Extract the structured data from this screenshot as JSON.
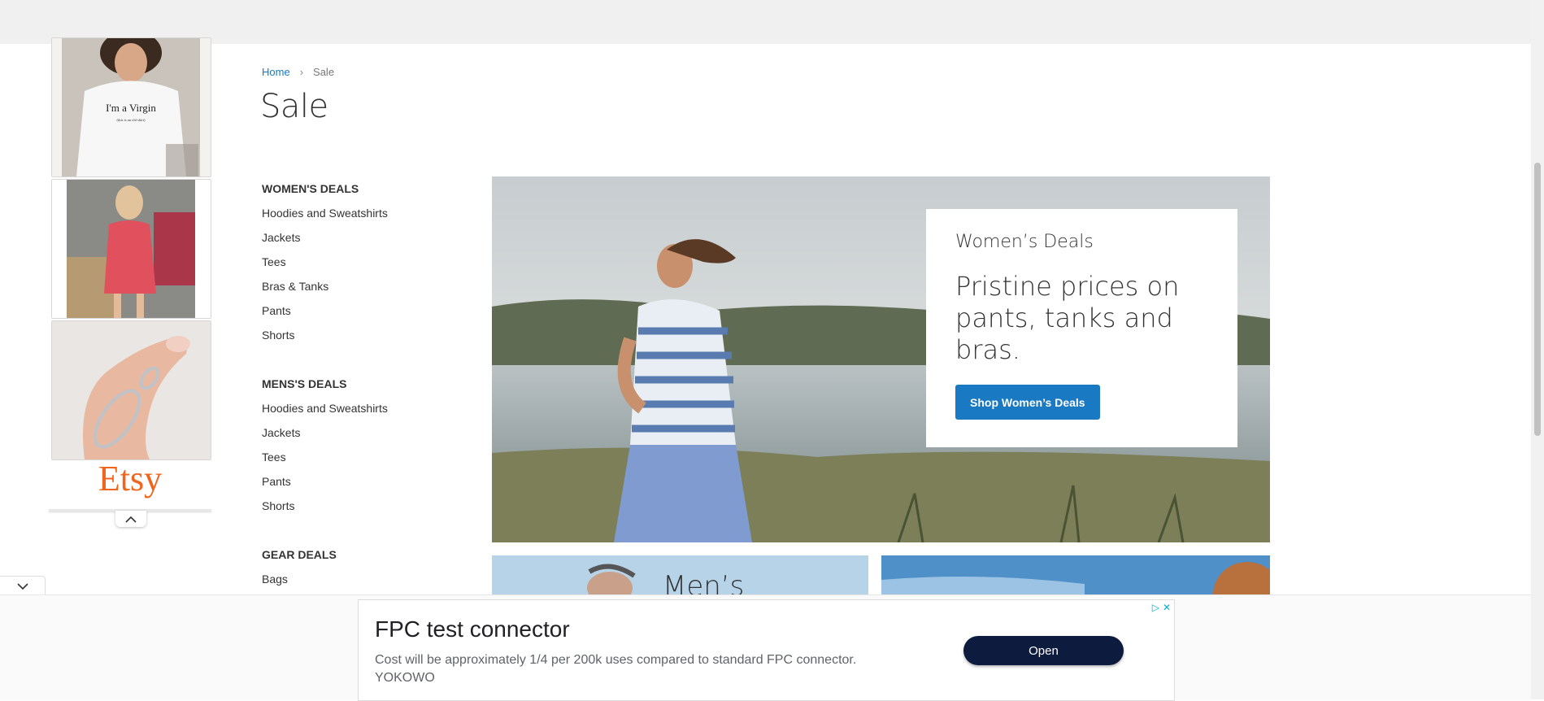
{
  "left_ad": {
    "shirt_text_line1": "I'm a Virgin",
    "shirt_text_line2": "(this is an old shirt)",
    "brand": "Etsy",
    "adchoices_icon": "adchoices-icon",
    "close_icon": "close-icon"
  },
  "breadcrumb": {
    "home": "Home",
    "current": "Sale"
  },
  "page_title": "Sale",
  "sidebar": {
    "womens": {
      "title": "WOMEN'S DEALS",
      "links": [
        "Hoodies and Sweatshirts",
        "Jackets",
        "Tees",
        "Bras & Tanks",
        "Pants",
        "Shorts"
      ]
    },
    "mens": {
      "title": "MENS'S DEALS",
      "links": [
        "Hoodies and Sweatshirts",
        "Jackets",
        "Tees",
        "Pants",
        "Shorts"
      ]
    },
    "gear": {
      "title": "GEAR DEALS",
      "links": [
        "Bags"
      ]
    }
  },
  "hero": {
    "eyebrow": "Women’s Deals",
    "headline": "Pristine prices on pants, tanks and bras.",
    "cta": "Shop Women’s Deals"
  },
  "promos": {
    "men_label": "Men’s Bargains"
  },
  "anchor_ad": {
    "title": "FPC test connector",
    "description": "Cost will be approximately 1/4 per 200k uses compared to standard FPC connector.",
    "advertiser": "YOKOWO",
    "open_button": "Open"
  },
  "colors": {
    "accent": "#1979c3",
    "etsy": "#f1641e",
    "ad_button": "#0d1b3e"
  }
}
